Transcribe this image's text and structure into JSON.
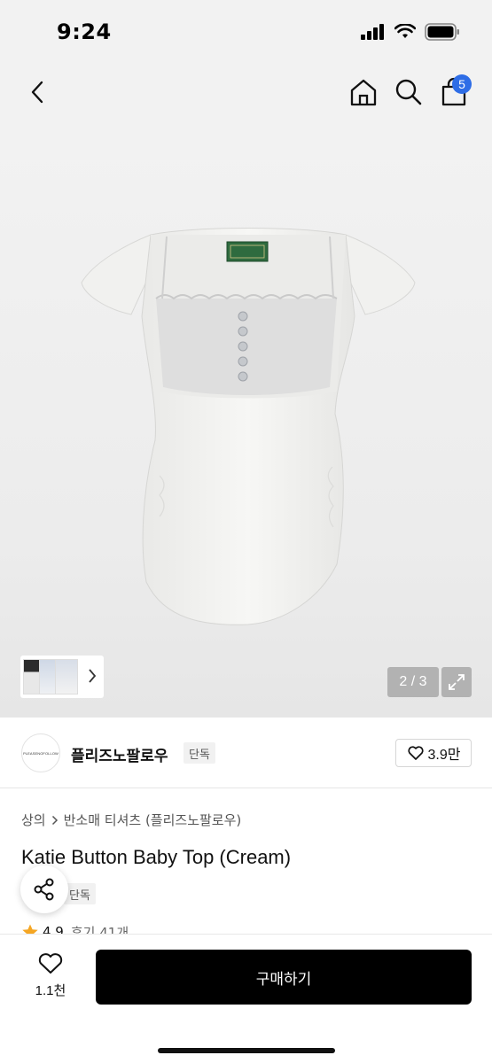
{
  "status_bar": {
    "time": "9:24"
  },
  "nav": {
    "cart_badge_count": "5"
  },
  "gallery": {
    "counter": "2 / 3"
  },
  "brand": {
    "logo_text": "PLEASENOFOLLOW",
    "name": "플리즈노팔로우",
    "tag": "단독",
    "like_count": "3.9만"
  },
  "breadcrumb": {
    "level1": "상의",
    "level2": "반소매 티셔츠 (플리즈노팔로우)"
  },
  "product": {
    "title": "Katie Button Baby Top (Cream)",
    "exclusive_tag": "단독",
    "rating": "4.9",
    "reviews": "후기 41개"
  },
  "bottom_bar": {
    "wish_count": "1.1천",
    "buy_label": "구매하기"
  },
  "colors": {
    "badge": "#2e6de6",
    "buy_button": "#000000",
    "star": "#f5a623",
    "hero_bg": "#eeeeee"
  },
  "icons": [
    "back-icon",
    "home-icon",
    "search-icon",
    "cart-icon",
    "chevron-right-icon",
    "expand-icon",
    "heart-icon",
    "share-icon",
    "star-icon",
    "signal-icon",
    "wifi-icon",
    "battery-icon"
  ]
}
